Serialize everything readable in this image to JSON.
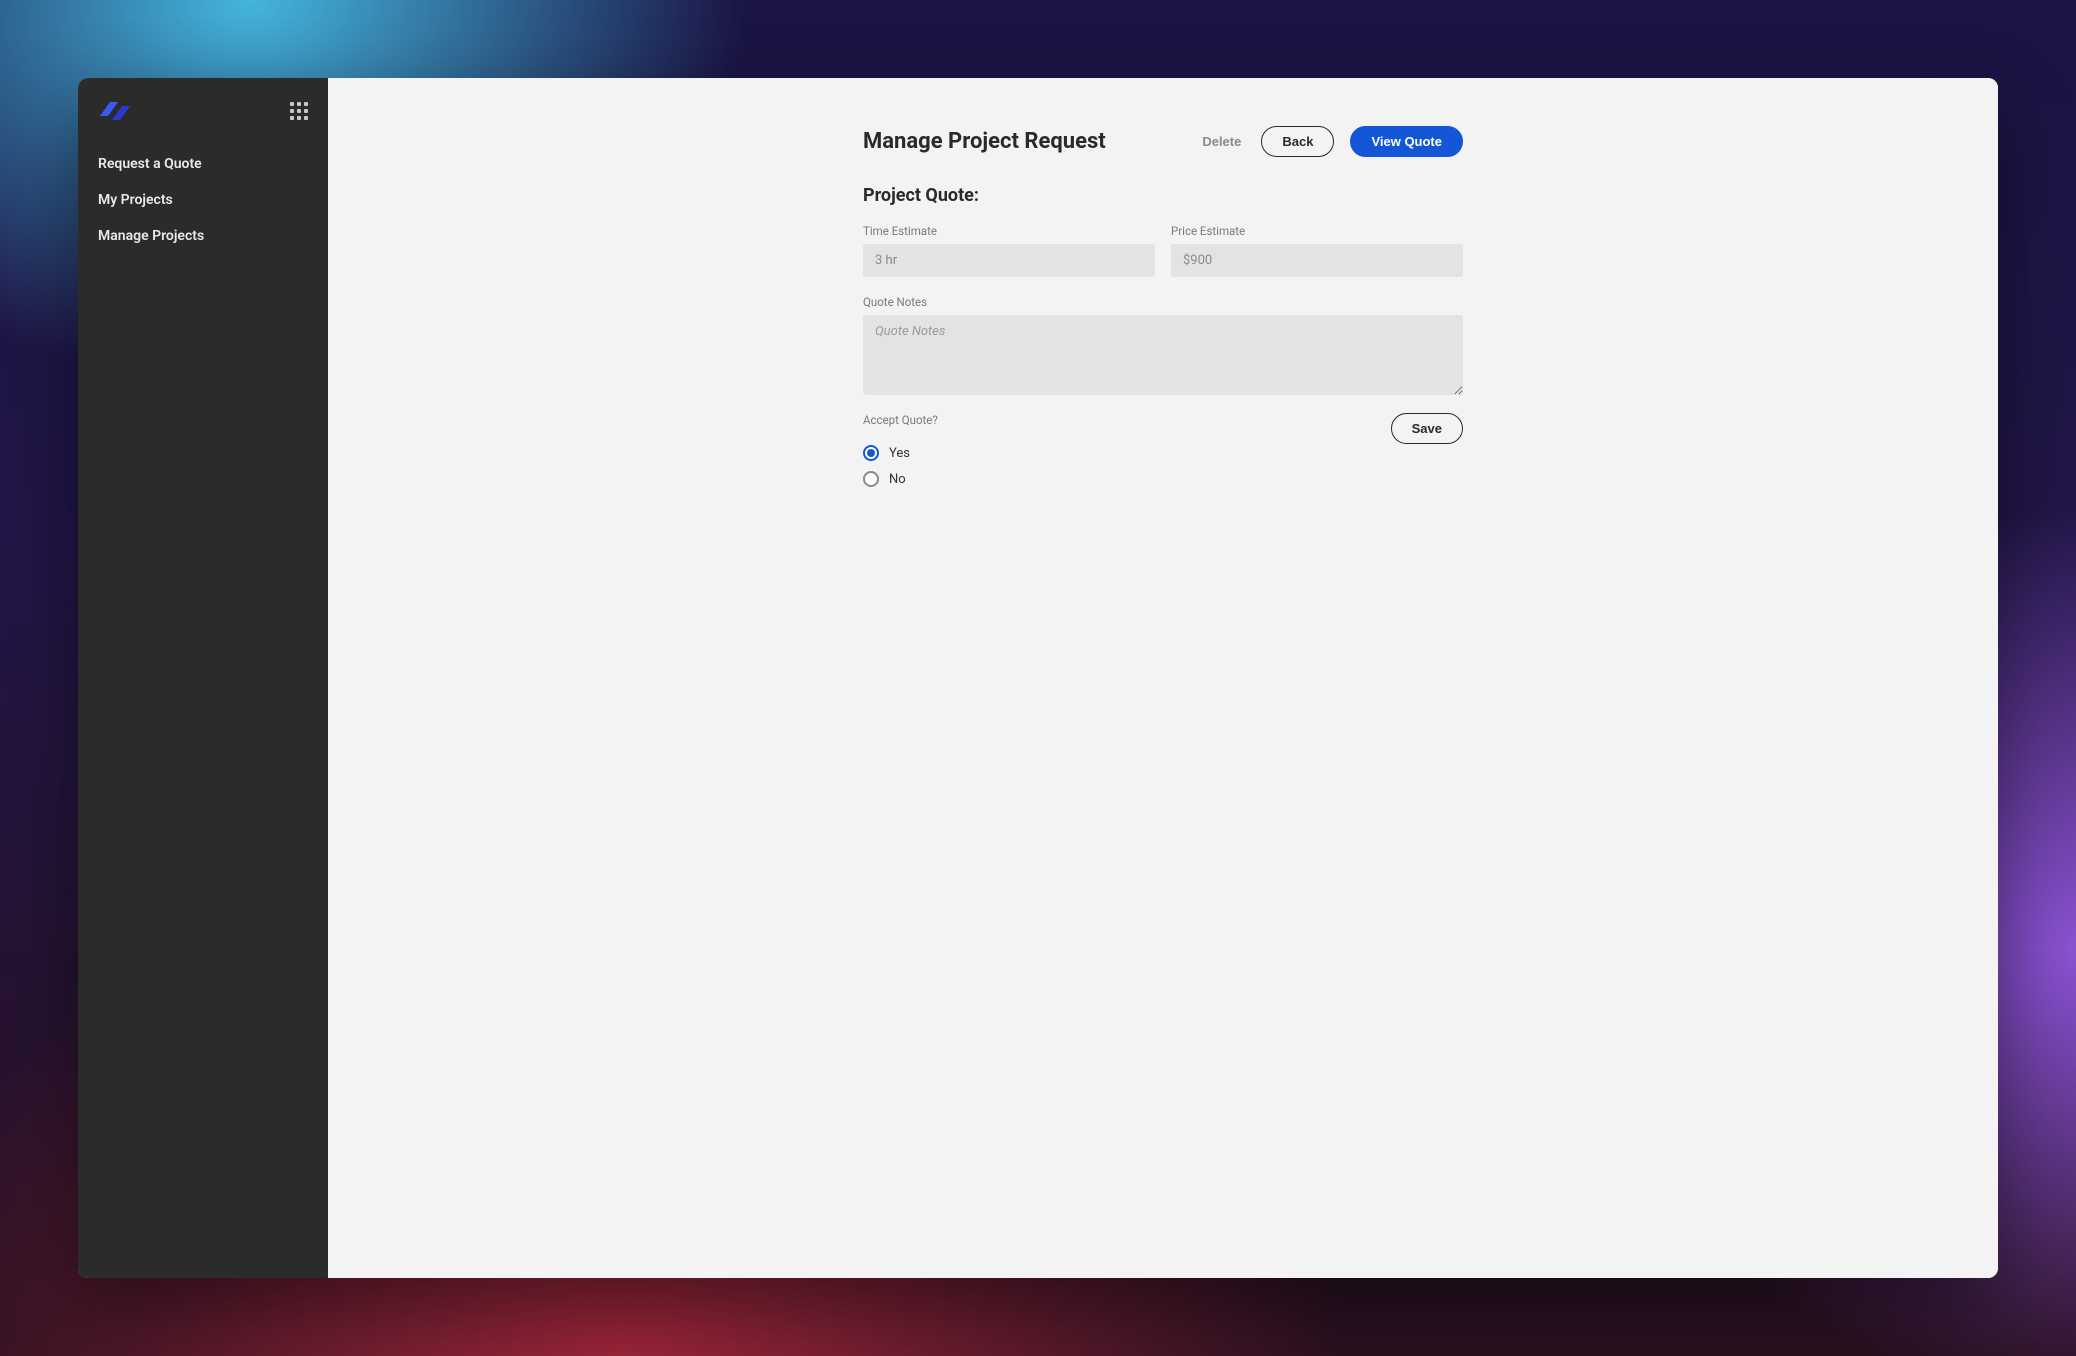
{
  "sidebar": {
    "items": [
      {
        "label": "Request a Quote"
      },
      {
        "label": "My Projects"
      },
      {
        "label": "Manage Projects"
      }
    ]
  },
  "header": {
    "title": "Manage Project Request",
    "actions": {
      "delete_label": "Delete",
      "back_label": "Back",
      "view_quote_label": "View Quote"
    }
  },
  "quote": {
    "section_title": "Project Quote:",
    "time_estimate": {
      "label": "Time Estimate",
      "value": "3 hr"
    },
    "price_estimate": {
      "label": "Price Estimate",
      "value": "$900"
    },
    "notes": {
      "label": "Quote Notes",
      "placeholder": "Quote Notes",
      "value": ""
    },
    "accept": {
      "label": "Accept Quote?",
      "options": {
        "yes": "Yes",
        "no": "No"
      },
      "selected": "yes"
    },
    "save_label": "Save"
  }
}
